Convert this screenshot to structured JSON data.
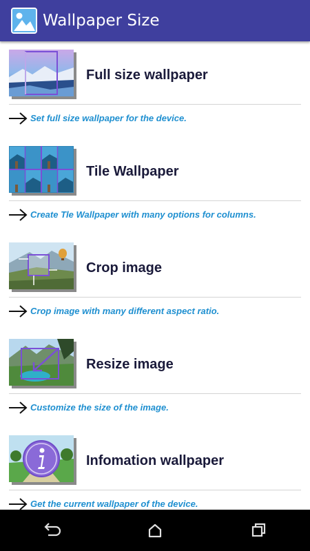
{
  "app": {
    "title": "Wallpaper Size",
    "icon": "image-app-icon",
    "bar_color": "#3f3f9e"
  },
  "items": [
    {
      "title": "Full size wallpaper",
      "description": "Set full size wallpaper for the device.",
      "icon": "full-size-wallpaper-icon"
    },
    {
      "title": "Tile Wallpaper",
      "description": "Create Tle Wallpaper with many options for columns.",
      "icon": "tile-wallpaper-icon"
    },
    {
      "title": "Crop image",
      "description": "Crop image with many different aspect ratio.",
      "icon": "crop-image-icon"
    },
    {
      "title": "Resize image",
      "description": "Customize the size of the image.",
      "icon": "resize-image-icon"
    },
    {
      "title": "Infomation wallpaper",
      "description": "Get the current wallpaper of the device.",
      "icon": "info-wallpaper-icon"
    }
  ],
  "nav": {
    "back": "back-icon",
    "home": "home-icon",
    "recents": "recents-icon"
  },
  "colors": {
    "title_text": "#1a1a3a",
    "description_text": "#1e8fd0",
    "accent_frame": "#7a4fd6"
  }
}
